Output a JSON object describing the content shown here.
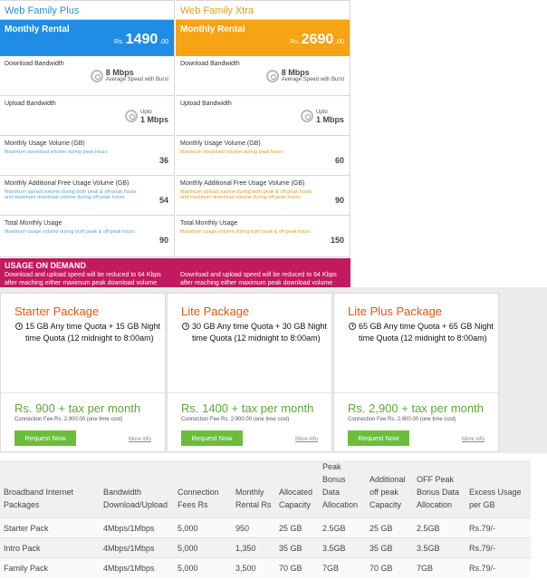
{
  "plans": [
    {
      "name": "Web Family Plus",
      "rental_label": "Monthly Rental",
      "currency": "Rs.",
      "price": "1490",
      "cents": ".00",
      "download_label": "Download Bandwidth",
      "download_speed": "8 Mbps",
      "download_note": "Average Speed with Burst",
      "upload_label": "Upload Bandwidth",
      "upload_prefix": "Upto",
      "upload_speed": "1 Mbps",
      "usage_label": "Monthly Usage Volume (GB)",
      "usage_note": "Maximum download volume during peak hours",
      "usage_value": "36",
      "free_label": "Monthly Additional Free Usage Volume (GB)",
      "free_note": "Maximum upload volume during both peak & off-peak hours and maximum download volume during off-peak hours",
      "free_value": "54",
      "total_label": "Total Monthly Usage",
      "total_note": "Maximum usage volume during both peak & off-peak hours",
      "total_value": "90"
    },
    {
      "name": "Web Family Xtra",
      "rental_label": "Monthly Rental",
      "currency": "Rs.",
      "price": "2690",
      "cents": ".00",
      "download_label": "Download Bandwidth",
      "download_speed": "8 Mbps",
      "download_note": "Average Speed with Burst",
      "upload_label": "Upload Bandwidth",
      "upload_prefix": "Upto",
      "upload_speed": "1 Mbps",
      "usage_label": "Monthly Usage Volume (GB)",
      "usage_note": "Maximum download volume during peak hours",
      "usage_value": "60",
      "free_label": "Monthly Additional Free Usage Volume (GB)",
      "free_note": "Maximum upload volume during both peak & off-peak hours and maximum download volume during off-peak hours",
      "free_value": "90",
      "total_label": "Total Monthly Usage",
      "total_note": "Maximum usage volume during both peak & off-peak hours",
      "total_value": "150"
    }
  ],
  "usage_on_demand": {
    "title": "USAGE ON DEMAND",
    "text": "Download and upload speed will be reduced to 64 Kbps after reaching either maximum peak download volume"
  },
  "packages": [
    {
      "title": "Starter Package",
      "quota": "15 GB Any time Quota + 15 GB Night time Quota (12 midnight to 8:00am)",
      "price": "Rs. 900 + tax per month",
      "fee": "Connection Fee  Rs. 2,900.00  (one time cost)",
      "button": "Request Now",
      "more": "More info"
    },
    {
      "title": "Lite Package",
      "quota": "30 GB Any time Quota + 30 GB Night time Quota (12 midnight to 8:00am)",
      "price": "Rs. 1400 + tax per month",
      "fee": "Connection Fee  Rs. 2,900.00  (one time cost)",
      "button": "Request Now",
      "more": "More info"
    },
    {
      "title": "Lite Plus Package",
      "quota": "65 GB Any time Quota + 65 GB Night time Quota (12 midnight to 8:00am)",
      "price": "Rs. 2,900 + tax per month",
      "fee": "Connection Fee  Rs. 2,900.00  (one time cost)",
      "button": "Request Now",
      "more": "More info"
    }
  ],
  "table": {
    "headers": [
      "Broadband Internet Packages",
      "Bandwidth Download/Upload",
      "Connection Fees Rs",
      "Monthly Rental Rs",
      "Allocated Capacity",
      "Peak Bonus Data Allocation",
      "Additional off peak Capacity",
      "OFF Peak Bonus Data Allocation",
      "Excess Usage per GB"
    ],
    "rows": [
      [
        "Starter Pack",
        "4Mbps/1Mbps",
        "5,000",
        "950",
        "25 GB",
        "2.5GB",
        "25 GB",
        "2.5GB",
        "Rs.79/-"
      ],
      [
        "Intro Pack",
        "4Mbps/1Mbps",
        "5,000",
        "1,350",
        "35 GB",
        "3.5GB",
        "35 GB",
        "3.5GB",
        "Rs.79/-"
      ],
      [
        "Family Pack",
        "4Mbps/1Mbps",
        "5,000",
        "3,500",
        "70 GB",
        "7GB",
        "70 GB",
        "7GB",
        "Rs.79/-"
      ]
    ]
  },
  "colors": {
    "plus_blue": "#1f8de6",
    "xtra_orange": "#f6a414",
    "demand_magenta": "#c2195f",
    "package_orange": "#e8560f",
    "price_green": "#5fa834",
    "button_green": "#6cbd3c"
  },
  "icons": {
    "speed": "speedometer-icon",
    "clock": "clock-icon"
  }
}
